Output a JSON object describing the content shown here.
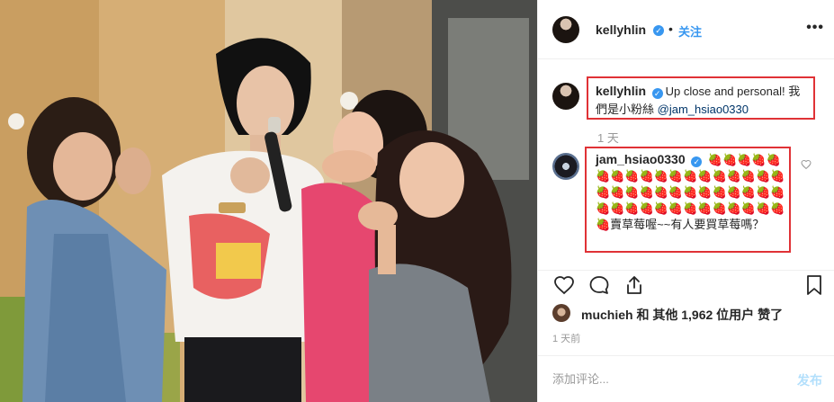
{
  "post": {
    "author": "kellyhlin",
    "follow_label": "关注",
    "separator": "•",
    "more_label": "•••",
    "photo_alt": "Photo of four people posing, one singing into a microphone"
  },
  "caption": {
    "username": "kellyhlin",
    "text": "Up close and personal! 我們是小粉絲 ",
    "mention": "@jam_hsiao0330",
    "time": "1 天"
  },
  "comment": {
    "username": "jam_hsiao0330",
    "text": "🍓🍓🍓🍓🍓🍓🍓🍓🍓🍓🍓🍓🍓🍓🍓🍓🍓🍓🍓🍓🍓🍓🍓🍓🍓🍓🍓🍓🍓🍓🍓🍓🍓🍓🍓🍓🍓🍓🍓🍓🍓🍓🍓🍓🍓賣草莓喔~~有人要買草莓嗎？"
  },
  "likes": {
    "user": "muchieh",
    "and_others": " 和 其他 ",
    "count": "1,962",
    "suffix": " 位用户 赞了"
  },
  "time_ago": "1 天前",
  "add_comment": {
    "placeholder": "添加评论...",
    "post_label": "发布"
  },
  "colors": {
    "accent": "#3897f0",
    "highlight_box": "#e03236",
    "muted": "#999999"
  },
  "icons": [
    "verified-badge-icon",
    "heart-icon",
    "comment-icon",
    "share-icon",
    "bookmark-icon",
    "more-options-icon"
  ]
}
